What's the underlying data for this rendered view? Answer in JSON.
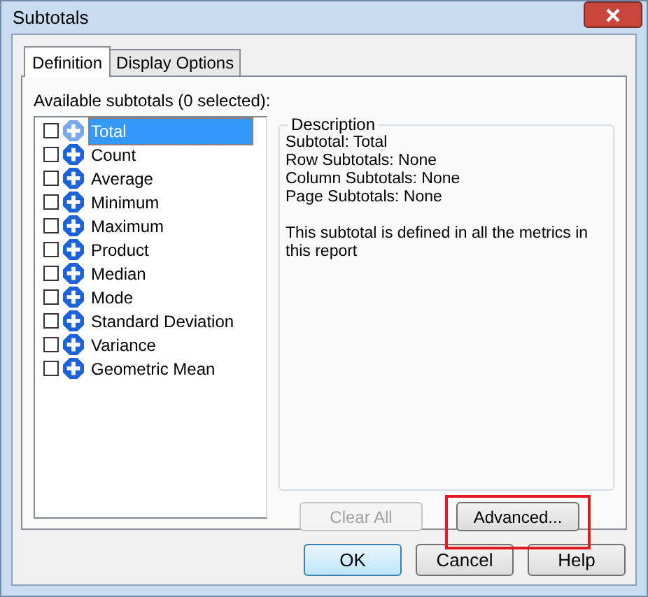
{
  "window": {
    "title": "Subtotals"
  },
  "tabs": [
    {
      "label": "Definition",
      "selected": true
    },
    {
      "label": "Display Options",
      "selected": false
    }
  ],
  "list_label": "Available subtotals (0 selected):",
  "subtotals": [
    {
      "label": "Total",
      "checked": false,
      "selected": true
    },
    {
      "label": "Count",
      "checked": false,
      "selected": false
    },
    {
      "label": "Average",
      "checked": false,
      "selected": false
    },
    {
      "label": "Minimum",
      "checked": false,
      "selected": false
    },
    {
      "label": "Maximum",
      "checked": false,
      "selected": false
    },
    {
      "label": "Product",
      "checked": false,
      "selected": false
    },
    {
      "label": "Median",
      "checked": false,
      "selected": false
    },
    {
      "label": "Mode",
      "checked": false,
      "selected": false
    },
    {
      "label": "Standard Deviation",
      "checked": false,
      "selected": false
    },
    {
      "label": "Variance",
      "checked": false,
      "selected": false
    },
    {
      "label": "Geometric Mean",
      "checked": false,
      "selected": false
    }
  ],
  "description": {
    "title": "Description",
    "lines": [
      "Subtotal: Total",
      "Row Subtotals: None",
      "Column Subtotals: None",
      "Page Subtotals: None"
    ],
    "note": "This subtotal is defined in all the metrics in this report"
  },
  "panel_buttons": [
    {
      "label": "Clear All",
      "disabled": true,
      "highlighted": false
    },
    {
      "label": "Advanced...",
      "disabled": false,
      "highlighted": true
    }
  ],
  "dialog_buttons": [
    {
      "label": "OK",
      "default": true
    },
    {
      "label": "Cancel",
      "default": false
    },
    {
      "label": "Help",
      "default": false
    }
  ]
}
